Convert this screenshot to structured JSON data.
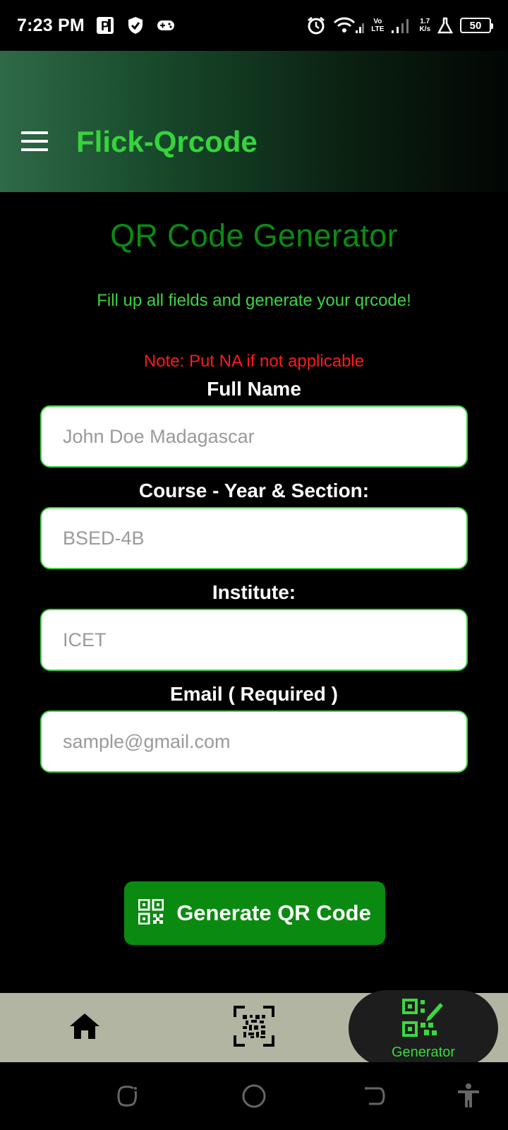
{
  "status_bar": {
    "time": "7:23 PM",
    "network_label_top": "Vo",
    "network_label_bottom": "LTE",
    "speed_top": "1.7",
    "speed_bottom": "K/s",
    "battery": "50",
    "icons": [
      "parking-p-icon",
      "shield-icon",
      "gamepad-icon",
      "alarm-icon",
      "wifi-icon",
      "signal-icon",
      "flask-icon",
      "battery-icon"
    ]
  },
  "app_bar": {
    "title": "Flick-Qrcode",
    "accent_color": "#35d43c"
  },
  "main": {
    "title": "QR Code Generator",
    "subtitle": "Fill up all fields and generate your qrcode!",
    "note": "Note: Put NA if not applicable",
    "fields": [
      {
        "label": "Full Name",
        "placeholder": "John Doe Madagascar"
      },
      {
        "label": "Course - Year & Section:",
        "placeholder": "BSED-4B"
      },
      {
        "label": "Institute:",
        "placeholder": "ICET"
      },
      {
        "label": "Email ( Required )",
        "placeholder": "sample@gmail.com"
      }
    ],
    "generate_button": {
      "label": "Generate QR Code",
      "icon": "qrcode-icon"
    }
  },
  "bottom_nav": {
    "items": [
      {
        "icon": "home-icon",
        "label": ""
      },
      {
        "icon": "barcode-scan-icon",
        "label": ""
      },
      {
        "icon": "qrcode-edit-icon",
        "label": "Generator",
        "active": true
      }
    ]
  },
  "system_nav": {
    "buttons": [
      "recent-apps-icon",
      "home-circle-icon",
      "back-icon",
      "accessibility-icon"
    ]
  }
}
